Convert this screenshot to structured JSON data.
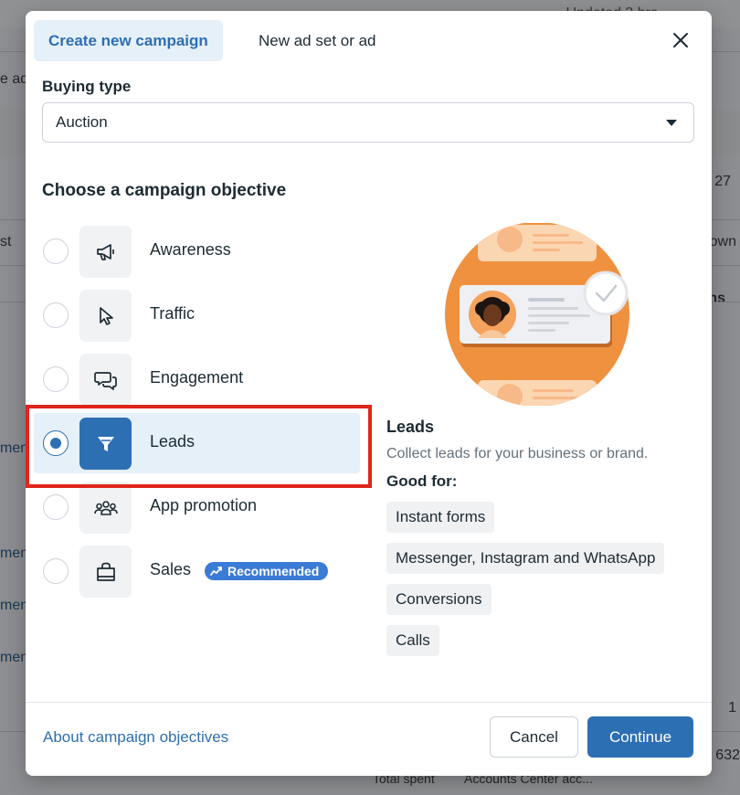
{
  "background": {
    "top_right_text": "Updated 3 hrs",
    "row_frag_left_1": "e ad",
    "row_frag_left_2": "st",
    "row_frag_right_1": "27",
    "row_frag_right_2": "own",
    "row_frag_right_3": "ns",
    "link_frags": [
      "men",
      "men",
      "men",
      "men"
    ],
    "num_frag_1": "1",
    "num_frag_2": "632",
    "col_total_spent": "Total spent",
    "col_accounts_center": "Accounts Center acc..."
  },
  "modal": {
    "tabs": {
      "create_new": "Create new campaign",
      "new_ad_set": "New ad set or ad"
    },
    "buying_type_label": "Buying type",
    "buying_type_value": "Auction",
    "objective_title": "Choose a campaign objective",
    "objectives": [
      {
        "label": "Awareness",
        "icon": "megaphone-icon",
        "selected": false
      },
      {
        "label": "Traffic",
        "icon": "cursor-icon",
        "selected": false
      },
      {
        "label": "Engagement",
        "icon": "chat-bubbles-icon",
        "selected": false
      },
      {
        "label": "Leads",
        "icon": "funnel-icon",
        "selected": true
      },
      {
        "label": "App promotion",
        "icon": "people-icon",
        "selected": false
      },
      {
        "label": "Sales",
        "icon": "shopping-bag-icon",
        "selected": false
      }
    ],
    "recommended_badge": "Recommended",
    "detail": {
      "title": "Leads",
      "description": "Collect leads for your business or brand.",
      "good_for_label": "Good for:",
      "good_for": [
        "Instant forms",
        "Messenger, Instagram and WhatsApp",
        "Conversions",
        "Calls"
      ]
    },
    "footer": {
      "about_link": "About campaign objectives",
      "cancel": "Cancel",
      "continue": "Continue"
    }
  },
  "colors": {
    "accent": "#2d6fb3",
    "selected_bg": "#e6f0f9",
    "highlight_border": "#e0251b",
    "illustration_orange": "#f0913f"
  }
}
